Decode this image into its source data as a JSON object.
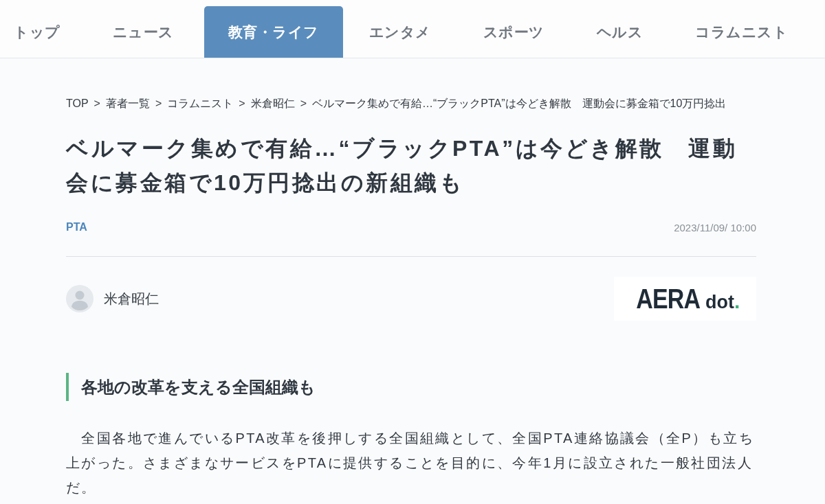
{
  "nav": {
    "tabs": [
      {
        "label": "トップ",
        "selected": false
      },
      {
        "label": "ニュース",
        "selected": false
      },
      {
        "label": "教育・ライフ",
        "selected": true
      },
      {
        "label": "エンタメ",
        "selected": false
      },
      {
        "label": "スポーツ",
        "selected": false
      },
      {
        "label": "ヘルス",
        "selected": false
      },
      {
        "label": "コラムニスト",
        "selected": false
      }
    ]
  },
  "breadcrumb": {
    "links": [
      "TOP",
      "著者一覧",
      "コラムニスト",
      "米倉昭仁"
    ],
    "separators": [
      ">",
      ">",
      ">",
      ">"
    ],
    "current": "ベルマーク集めで有給…“ブラックPTA”は今どき解散　運動会に募金箱で10万円捻出"
  },
  "article": {
    "title": "ベルマーク集めで有給…“ブラックPTA”は今どき解散　運動会に募金箱で10万円捻出の新組織も",
    "tag": "PTA",
    "date": "2023/11/09/ 10:00",
    "author": {
      "name": "米倉昭仁"
    },
    "logo": {
      "wordmark": "AERA",
      "suffix": "dot",
      "accent": "."
    }
  },
  "section": {
    "heading": "各地の改革を支える全国組織も",
    "paragraph": "　全国各地で進んでいるPTA改革を後押しする全国組織として、全国PTA連絡協議会（全P）も立ち上がった。さまざまなサービスをPTAに提供することを目的に、今年1月に設立された一般社団法人だ。"
  }
}
